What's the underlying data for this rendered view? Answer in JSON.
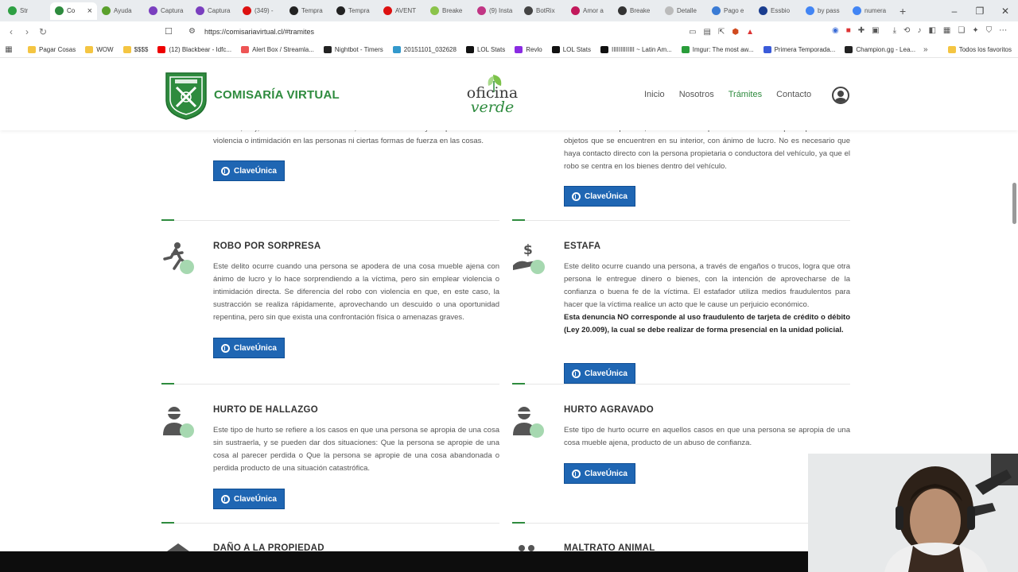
{
  "browser": {
    "tabs": [
      {
        "label": "Str",
        "color": "#2ea043"
      },
      {
        "label": "Co",
        "color": "#2e8b3e",
        "active": true
      },
      {
        "label": "Ayuda",
        "color": "#5aa02c"
      },
      {
        "label": "Captura",
        "color": "#7a3fbf"
      },
      {
        "label": "Captura",
        "color": "#7a3fbf"
      },
      {
        "label": "(349) -",
        "color": "#d11"
      },
      {
        "label": "Tempra",
        "color": "#222"
      },
      {
        "label": "Tempra",
        "color": "#222"
      },
      {
        "label": "AVENT",
        "color": "#d11"
      },
      {
        "label": "Breake",
        "color": "#8bc34a"
      },
      {
        "label": "(9) Insta",
        "color": "#c13584"
      },
      {
        "label": "BotRix",
        "color": "#444"
      },
      {
        "label": "Amor a",
        "color": "#c2185b"
      },
      {
        "label": "Breake",
        "color": "#333"
      },
      {
        "label": "Detalle",
        "color": "#bbb"
      },
      {
        "label": "Pago e",
        "color": "#3a7bd5"
      },
      {
        "label": "Essbio",
        "color": "#1a3d8f"
      },
      {
        "label": "by pass",
        "color": "#4285f4"
      },
      {
        "label": "numera",
        "color": "#4285f4"
      }
    ],
    "new_tab": "+",
    "url": "https://comisariavirtual.cl/#tramites",
    "bookmarks": [
      {
        "label": "Pagar Cosas",
        "color": "#f4c542"
      },
      {
        "label": "WOW",
        "color": "#f4c542"
      },
      {
        "label": "$$$$",
        "color": "#f4c542"
      },
      {
        "label": "(12) Blackbear - Idfc...",
        "color": "#e00"
      },
      {
        "label": "Alert Box / Streamla...",
        "color": "#e55"
      },
      {
        "label": "Nightbot - Timers",
        "color": "#222"
      },
      {
        "label": "20151101_032628",
        "color": "#39c"
      },
      {
        "label": "LOL Stats",
        "color": "#111"
      },
      {
        "label": "Revlo",
        "color": "#8a2be2"
      },
      {
        "label": "LOL Stats",
        "color": "#111"
      },
      {
        "label": "IIIIIIIIIIIII ~ Latin Am...",
        "color": "#111"
      },
      {
        "label": "Imgur: The most aw...",
        "color": "#2a9d3a"
      },
      {
        "label": "Primera Temporada...",
        "color": "#3a5bd9"
      },
      {
        "label": "Champion.gg - Lea...",
        "color": "#222"
      }
    ],
    "bookmarks_overflow": "»",
    "all_favorites": "Todos los favoritos"
  },
  "site": {
    "brand": "COMISARÍA VIRTUAL",
    "oficina_top": "oficina",
    "oficina_bottom": "verde",
    "nav": [
      "Inicio",
      "Nosotros",
      "Trámites",
      "Contacto"
    ]
  },
  "cards": {
    "top_left_text": "bicicleta, etc), sin la voluntad de su dueño, con ánimo de lucro y sin que concurran la violencia o intimidación en las personas ni ciertas formas de fuerza en las cosas.",
    "top_right_text": "autorización las puertas, ventanas u otras partes de un vehículo para apoderarse de objetos que se encuentren en su interior, con ánimo de lucro. No es necesario que haya contacto directo con la persona propietaria o conductora del vehículo, ya que el robo se centra en los bienes dentro del vehículo.",
    "robo_title": "ROBO POR SORPRESA",
    "robo_text": "Este delito ocurre cuando una persona se apodera de una cosa mueble ajena con ánimo de lucro y lo hace sorprendiendo a la víctima, pero sin emplear violencia o intimidación directa. Se diferencia del robo con violencia en que, en este caso, la sustracción se realiza rápidamente, aprovechando un descuido o una oportunidad repentina, pero sin que exista una confrontación física o amenazas graves.",
    "estafa_title": "ESTAFA",
    "estafa_text": "Este delito ocurre cuando una persona, a través de engaños o trucos, logra que otra persona le entregue dinero o bienes, con la intención de aprovecharse de la confianza o buena fe de la víctima. El estafador utiliza medios fraudulentos para hacer que la víctima realice un acto que le cause un perjuicio económico.",
    "estafa_note": "Esta denuncia NO corresponde al uso fraudulento de tarjeta de crédito o débito (Ley 20.009), la cual se debe realizar de forma presencial en la unidad policial.",
    "hallazgo_title": "HURTO DE HALLAZGO",
    "hallazgo_text": "Este tipo de hurto se refiere a los casos en que una persona se apropia de una cosa sin sustraerla, y se pueden dar dos situaciones: Que la persona se apropie de una cosa al parecer perdida o Que la persona se apropie de una cosa abandonada o perdida producto de una situación catastrófica.",
    "agravado_title": "HURTO AGRAVADO",
    "agravado_text": "Este tipo de hurto ocurre en aquellos casos en que una persona se apropia de una cosa mueble ajena, producto de un abuso de confianza.",
    "dano_title": "DAÑO A LA PROPIEDAD",
    "maltrato_title": "MALTRATO ANIMAL",
    "clave_label": "ClaveÚnica"
  }
}
